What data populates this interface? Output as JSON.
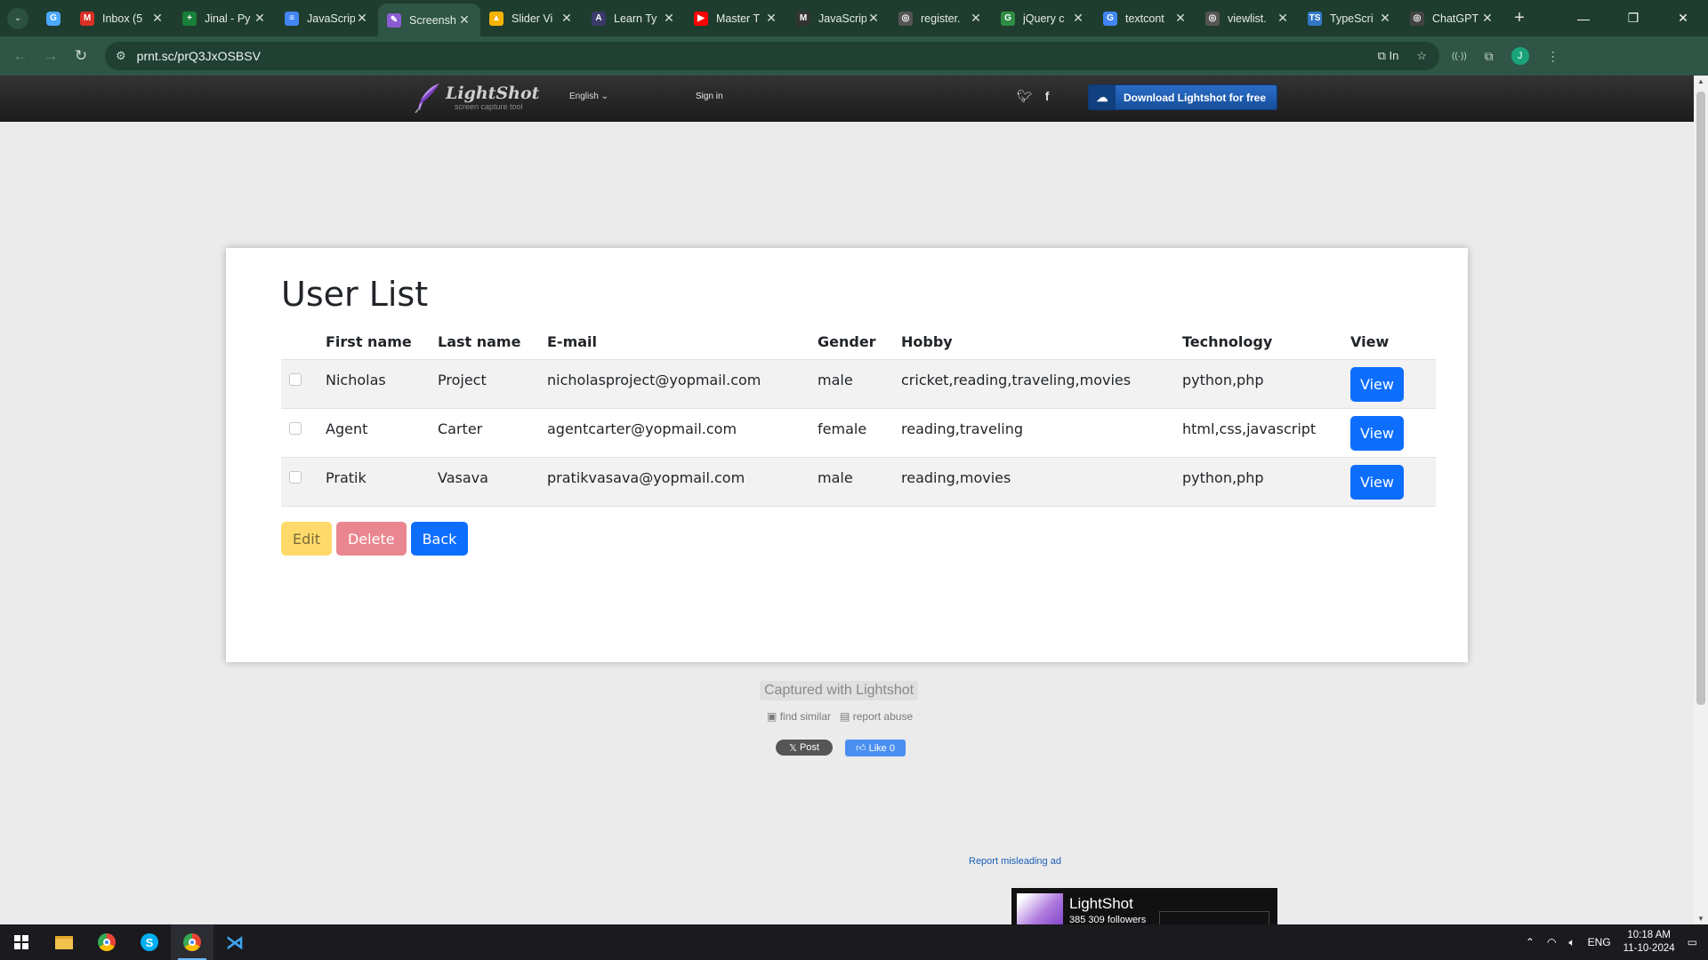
{
  "browser": {
    "tabs": [
      {
        "title": "Inbox (5",
        "color": "#d93025",
        "glyph": "M"
      },
      {
        "title": "Jinal - Py",
        "color": "#188038",
        "glyph": "+"
      },
      {
        "title": "JavaScrip",
        "color": "#4285f4",
        "glyph": "≡"
      },
      {
        "title": "Screensh",
        "color": "#8a5cd1",
        "glyph": "✎",
        "active": true
      },
      {
        "title": "Slider Vi",
        "color": "#f4b400",
        "glyph": "▲"
      },
      {
        "title": "Learn Ty",
        "color": "#3a3a6a",
        "glyph": "A"
      },
      {
        "title": "Master T",
        "color": "#ff0000",
        "glyph": "▶"
      },
      {
        "title": "JavaScrip",
        "color": "#333",
        "glyph": "M"
      },
      {
        "title": "register.",
        "color": "#555",
        "glyph": "◎"
      },
      {
        "title": "jQuery c",
        "color": "#2f8d46",
        "glyph": "G"
      },
      {
        "title": "textcont",
        "color": "#4285f4",
        "glyph": "G"
      },
      {
        "title": "viewlist.",
        "color": "#555",
        "glyph": "◎"
      },
      {
        "title": "TypeScri",
        "color": "#3178c6",
        "glyph": "TS"
      },
      {
        "title": "ChatGPT",
        "color": "#444",
        "glyph": "◎"
      }
    ],
    "url": "prnt.sc/prQ3JxOSBSV",
    "url_side_label": "In",
    "profile_initial": "J"
  },
  "lightshot": {
    "logo_name": "LightShot",
    "logo_tagline": "screen capture tool",
    "language": "English",
    "signin": "Sign in",
    "download": "Download Lightshot for free",
    "captured": "Captured with Lightshot",
    "find_similar": "find similar",
    "report_abuse": "report abuse",
    "post": "Post",
    "like": "Like 0",
    "report_ad": "Report misleading ad",
    "fb_name": "LightShot",
    "fb_followers": "385 309 followers"
  },
  "userlist": {
    "title": "User List",
    "headers": [
      "First name",
      "Last name",
      "E-mail",
      "Gender",
      "Hobby",
      "Technology",
      "View"
    ],
    "rows": [
      {
        "first": "Nicholas",
        "last": "Project",
        "email": "nicholasproject@yopmail.com",
        "gender": "male",
        "hobby": "cricket,reading,traveling,movies",
        "tech": "python,php",
        "view": "View"
      },
      {
        "first": "Agent",
        "last": "Carter",
        "email": "agentcarter@yopmail.com",
        "gender": "female",
        "hobby": "reading,traveling",
        "tech": "html,css,javascript",
        "view": "View"
      },
      {
        "first": "Pratik",
        "last": "Vasava",
        "email": "pratikvasava@yopmail.com",
        "gender": "male",
        "hobby": "reading,movies",
        "tech": "python,php",
        "view": "View"
      }
    ],
    "buttons": {
      "edit": "Edit",
      "delete": "Delete",
      "back": "Back"
    }
  },
  "taskbar": {
    "lang": "ENG",
    "time": "10:18 AM",
    "date": "11-10-2024"
  }
}
